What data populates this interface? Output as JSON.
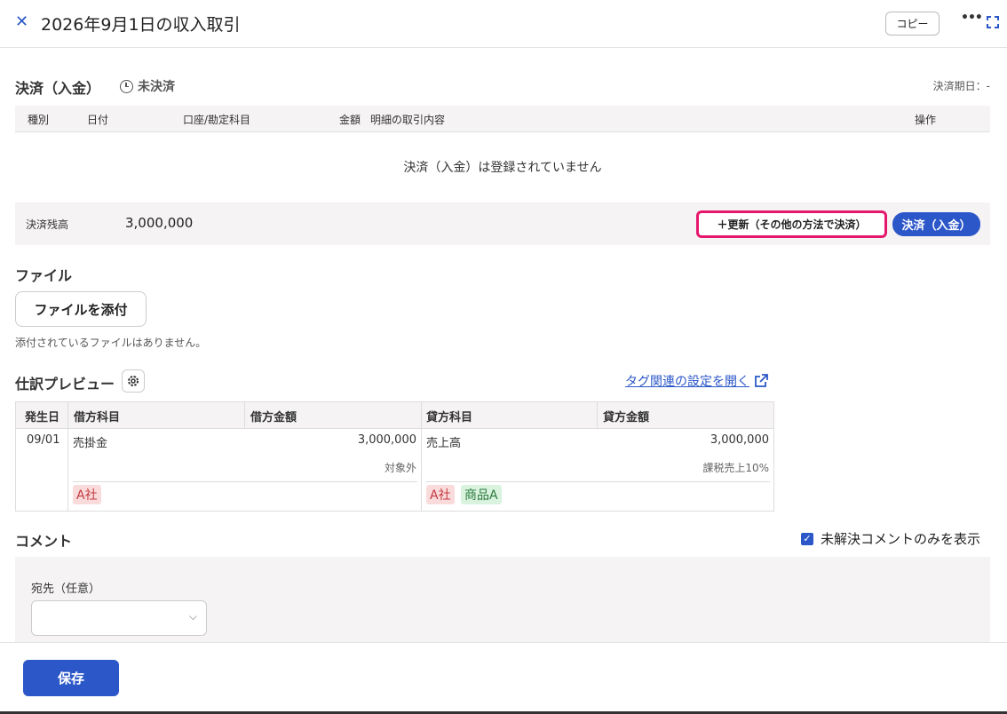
{
  "header": {
    "title": "2026年9月1日の収入取引",
    "copy_label": "コピー"
  },
  "settlement": {
    "title": "決済（入金）",
    "status": "未決済",
    "due_label": "決済期日：-",
    "columns": [
      "種別",
      "日付",
      "口座/勘定科目",
      "金額",
      "明細の取引内容",
      "操作"
    ],
    "empty_message": "決済（入金）は登録されていません",
    "balance_label": "決済残高",
    "balance_value": "3,000,000",
    "update_button": "＋更新（その他の方法で決済）",
    "settle_button": "決済（入金）"
  },
  "file": {
    "title": "ファイル",
    "attach_button": "ファイルを添付",
    "no_files": "添付されているファイルはありません。"
  },
  "journal": {
    "title": "仕訳プレビュー",
    "tag_link": "タグ関連の設定を開く",
    "columns": [
      "発生日",
      "借方科目",
      "借方金額",
      "貸方科目",
      "貸方金額"
    ],
    "row": {
      "date": "09/01",
      "debit_account": "売掛金",
      "debit_amount": "3,000,000",
      "debit_tax": "対象外",
      "credit_account": "売上高",
      "credit_amount": "3,000,000",
      "credit_tax": "課税売上10%",
      "debit_tags": [
        "A社"
      ],
      "credit_tags": [
        "A社",
        "商品A"
      ]
    }
  },
  "comment": {
    "title": "コメント",
    "unresolved_label": "未解決コメントのみを表示",
    "unresolved_checked": true,
    "dest_label": "宛先（任意）",
    "dest_value": ""
  },
  "footer": {
    "save_label": "保存"
  },
  "colors": {
    "primary": "#2b57c8",
    "highlight": "#e5176d",
    "tag_red": "#fadbdc",
    "tag_green": "#d9f3df"
  }
}
